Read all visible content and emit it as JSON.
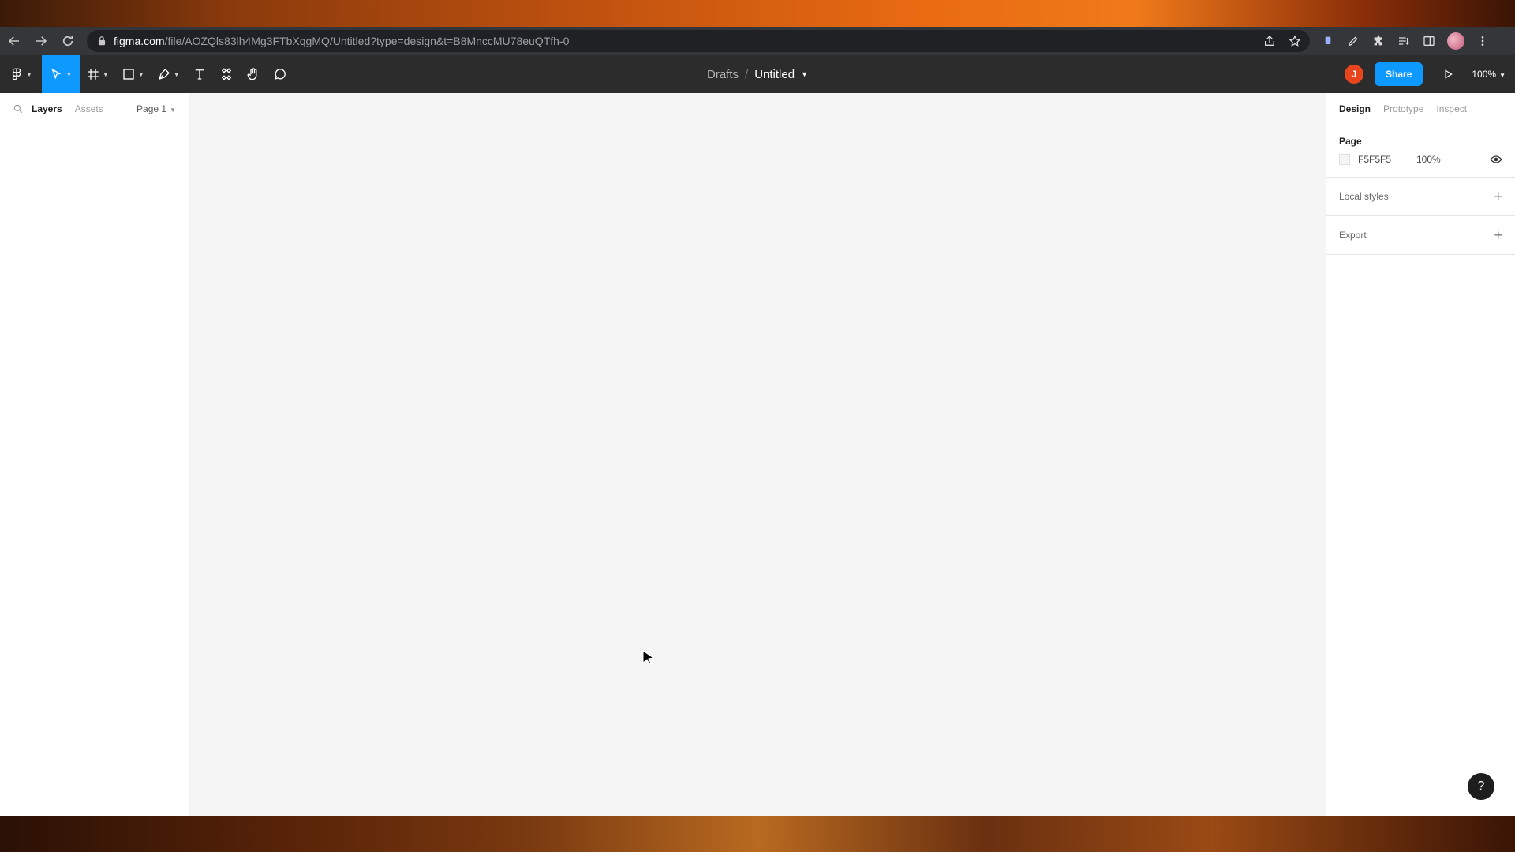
{
  "browser": {
    "url_host": "figma.com",
    "url_path": "/file/AOZQls83lh4Mg3FTbXqgMQ/Untitled?type=design&t=B8MnccMU78euQTfh-0"
  },
  "toolbar": {
    "breadcrumb_drafts": "Drafts",
    "breadcrumb_separator": "/",
    "file_title": "Untitled",
    "user_initial": "J",
    "share_label": "Share",
    "zoom_level": "100%"
  },
  "left_panel": {
    "tab_layers": "Layers",
    "tab_assets": "Assets",
    "page_select": "Page 1"
  },
  "right_panel": {
    "tab_design": "Design",
    "tab_prototype": "Prototype",
    "tab_inspect": "Inspect",
    "page_section_title": "Page",
    "page_color_hex": "F5F5F5",
    "page_opacity": "100%",
    "local_styles_label": "Local styles",
    "export_label": "Export"
  },
  "help": {
    "label": "?"
  },
  "colors": {
    "accent": "#0d99ff",
    "toolbar_bg": "#2c2c2c",
    "canvas_bg": "#f5f5f5",
    "avatar_bg": "#e8451e"
  }
}
